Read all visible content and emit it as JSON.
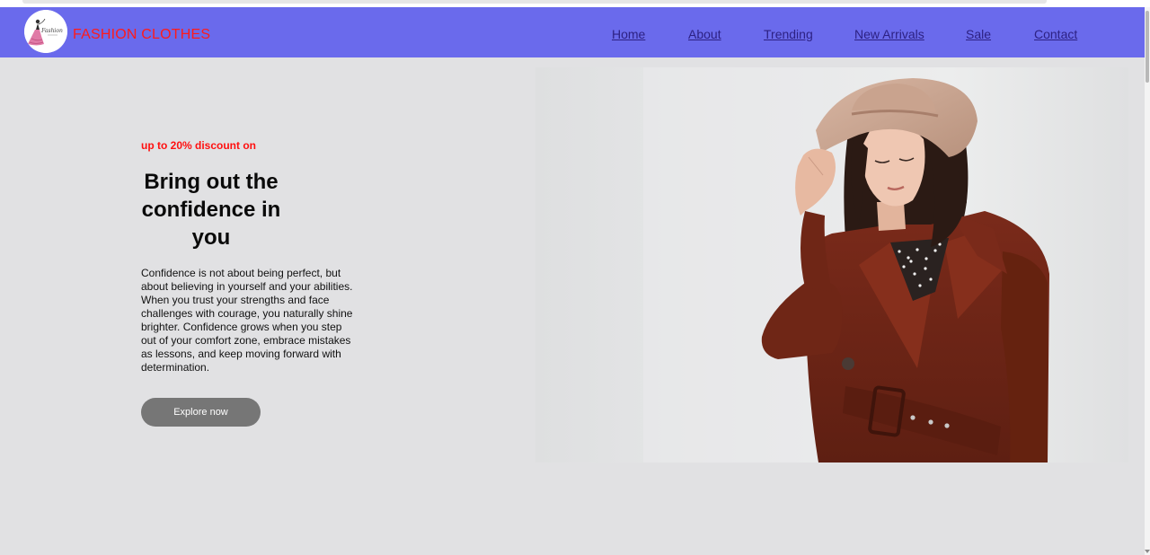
{
  "brand": {
    "name": "FASHION CLOTHES",
    "logo_text": "Fashion",
    "color": "#ff1a1a"
  },
  "nav": {
    "background": "#6a6aec",
    "link_color": "#2d2183",
    "links": [
      {
        "label": "Home"
      },
      {
        "label": "About"
      },
      {
        "label": "Trending"
      },
      {
        "label": "New Arrivals"
      },
      {
        "label": "Sale"
      },
      {
        "label": "Contact"
      }
    ]
  },
  "hero": {
    "discount": "up to 20% discount on",
    "headline": "Bring out the confidence in you",
    "description": "Confidence is not about being perfect, but about believing in yourself and your abilities. When you trust your strengths and face challenges with courage, you naturally shine brighter. Confidence grows when you step out of your comfort zone, embrace mistakes as lessons, and keep moving forward with determination.",
    "cta_label": "Explore now",
    "image_subject": "woman in brown trench coat and beige hat"
  },
  "colors": {
    "page_background": "#e1e1e3",
    "discount": "#ff1010",
    "button": "#767676"
  }
}
